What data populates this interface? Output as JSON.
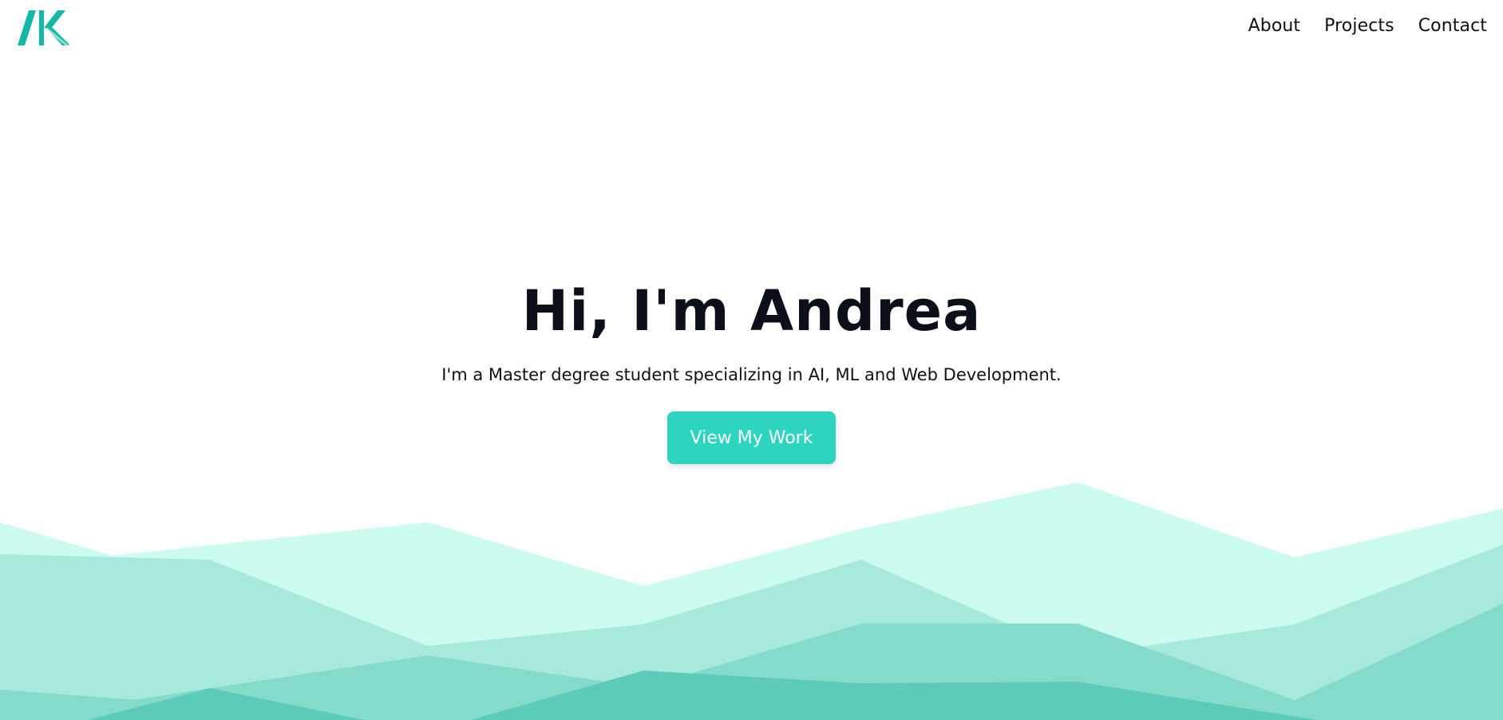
{
  "header": {
    "logo_icon": "ak-monogram-logo",
    "nav": [
      {
        "label": "About"
      },
      {
        "label": "Projects"
      },
      {
        "label": "Contact"
      }
    ]
  },
  "hero": {
    "title": "Hi, I'm Andrea",
    "subtitle": "I'm a Master degree student specializing in AI, ML and Web Development.",
    "cta_label": "View My Work"
  },
  "colors": {
    "accent": "#2dd4bf",
    "logo": "#14b8a6",
    "mountain_layer_1": "#ccfbef",
    "mountain_layer_2": "#a7e9da",
    "mountain_layer_3": "#84dbc9",
    "mountain_layer_4": "#5ccbb7",
    "text": "#0b0f1a"
  }
}
